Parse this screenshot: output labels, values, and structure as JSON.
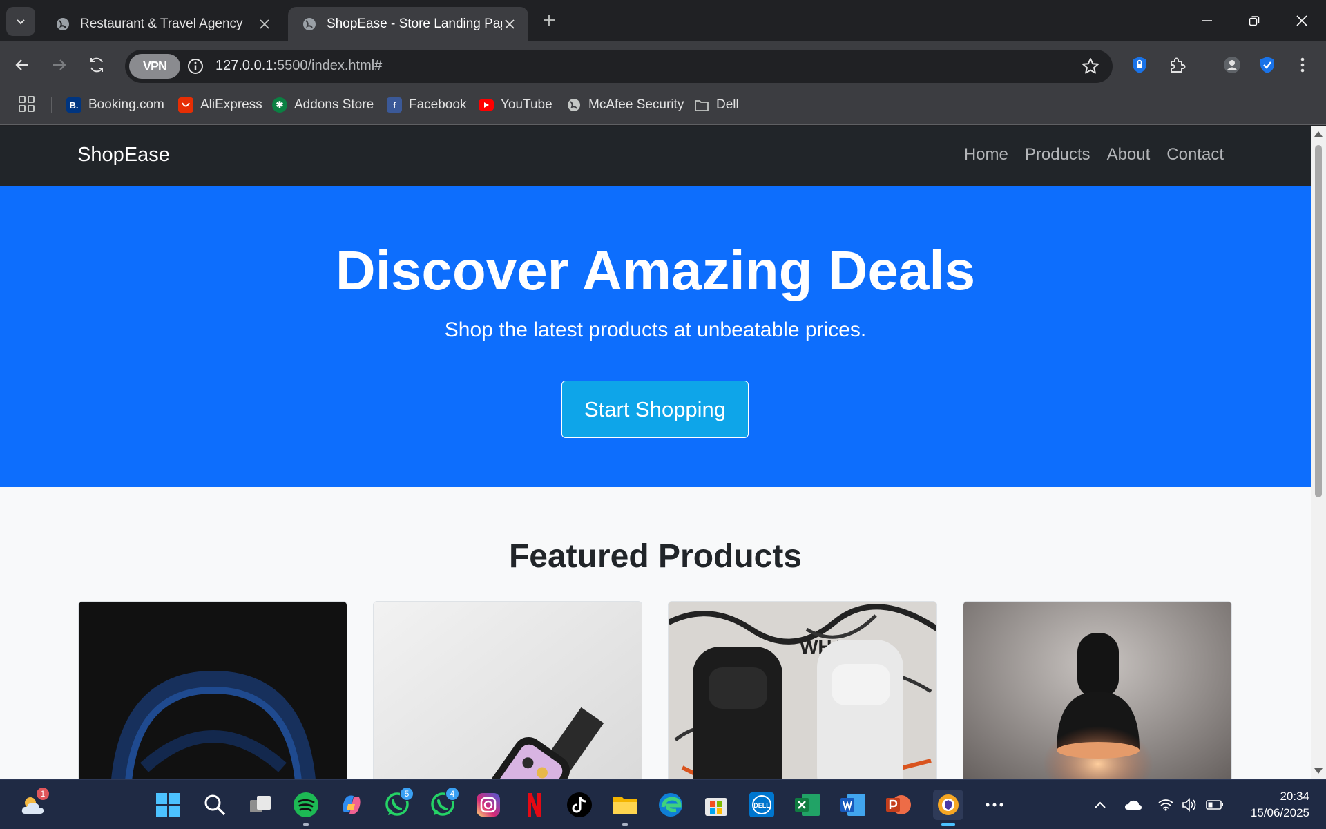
{
  "browser": {
    "tabs": [
      {
        "title": "Restaurant & Travel Agency",
        "active": false
      },
      {
        "title": "ShopEase - Store Landing Page",
        "active": true
      }
    ],
    "vpn_label": "VPN",
    "url_host": "127.0.0.1",
    "url_rest": ":5500/index.html#",
    "bookmarks": [
      {
        "label": "Booking.com",
        "icon": "booking-icon"
      },
      {
        "label": "AliExpress",
        "icon": "aliexpress-icon"
      },
      {
        "label": "Addons Store",
        "icon": "addons-icon"
      },
      {
        "label": "Facebook",
        "icon": "facebook-icon"
      },
      {
        "label": "YouTube",
        "icon": "youtube-icon"
      },
      {
        "label": "McAfee Security",
        "icon": "globe-icon"
      },
      {
        "label": "Dell",
        "icon": "folder-icon"
      }
    ]
  },
  "site": {
    "brand": "ShopEase",
    "nav": [
      "Home",
      "Products",
      "About",
      "Contact"
    ],
    "hero": {
      "title": "Discover Amazing Deals",
      "subtitle": "Shop the latest products at unbeatable prices.",
      "cta": "Start Shopping"
    },
    "featured_title": "Featured Products",
    "products": [
      {
        "image": "blue headphones on black background"
      },
      {
        "image": "smartwatch on white surface"
      },
      {
        "image": "black and white backpacks on graffiti wall"
      },
      {
        "image": "black desk lamp on textured wall"
      }
    ],
    "colors": {
      "navbar": "#212529",
      "hero": "#0d6efd",
      "cta": "#0ea5e9",
      "page_bg": "#f8f9fa"
    }
  },
  "taskbar": {
    "weather_badge": "1",
    "whatsapp_badge_1": "5",
    "whatsapp_badge_2": "4",
    "time": "20:34",
    "date": "15/06/2025"
  }
}
